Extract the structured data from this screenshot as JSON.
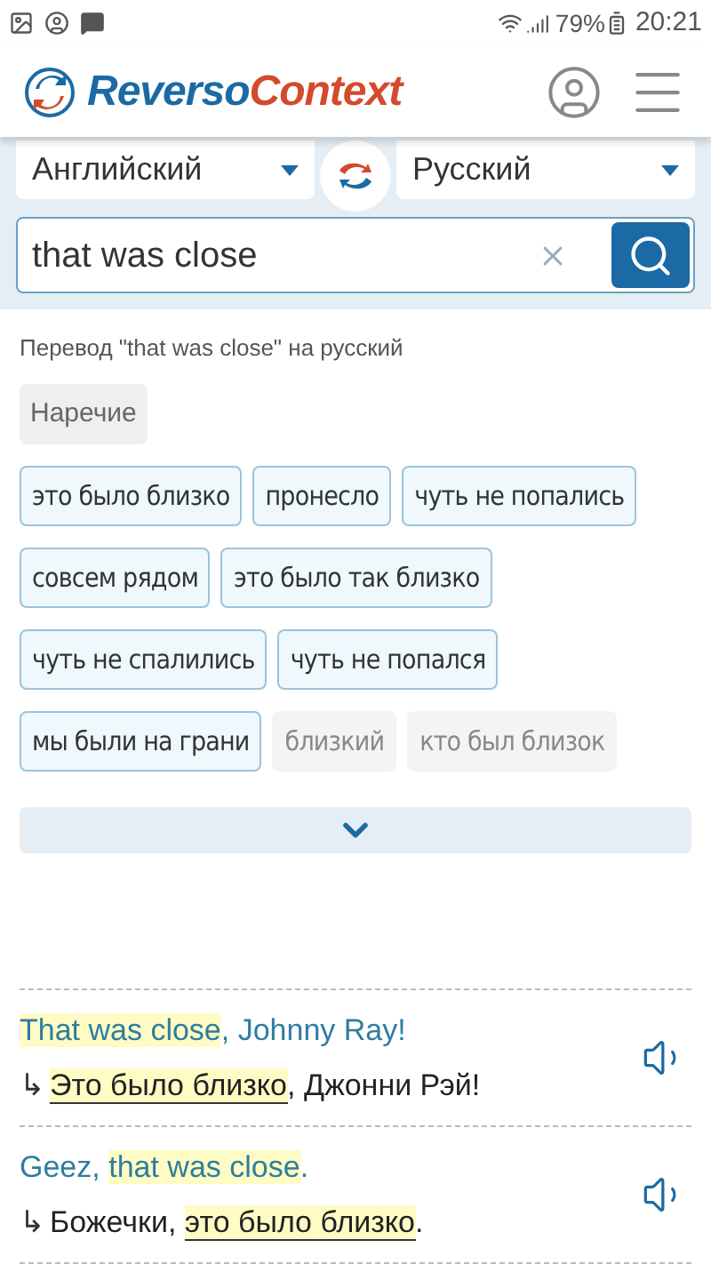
{
  "status_bar": {
    "battery": "79%",
    "time": "20:21"
  },
  "header": {
    "logo_part_1": "Reverso",
    "logo_part_2": "Context"
  },
  "languages": {
    "source": "Английский",
    "target": "Русский"
  },
  "search": {
    "value": "that was close"
  },
  "translation_heading": "Перевод \"that was close\" на русский",
  "part_of_speech": "Наречие",
  "translations": [
    {
      "text": "это было близко",
      "kind": "frequent"
    },
    {
      "text": "пронесло",
      "kind": "frequent"
    },
    {
      "text": "чуть не попались",
      "kind": "frequent"
    },
    {
      "text": "совсем рядом",
      "kind": "frequent"
    },
    {
      "text": "это было так близко",
      "kind": "frequent"
    },
    {
      "text": "чуть не спалились",
      "kind": "frequent"
    },
    {
      "text": "чуть не попался",
      "kind": "frequent"
    },
    {
      "text": "мы были на грани",
      "kind": "frequent"
    },
    {
      "text": "близкий",
      "kind": "rare"
    },
    {
      "text": "кто был близок",
      "kind": "rare"
    }
  ],
  "examples": [
    {
      "source": [
        {
          "text": "That was close",
          "highlighted": true
        },
        {
          "text": ", Johnny Ray!",
          "highlighted": false
        }
      ],
      "arrow": "↳",
      "target": [
        {
          "text": "Это было близко",
          "highlighted": true
        },
        {
          "text": ", Джонни Рэй!",
          "highlighted": false
        }
      ]
    },
    {
      "source": [
        {
          "text": "Geez, ",
          "highlighted": false
        },
        {
          "text": "that was close",
          "highlighted": true
        },
        {
          "text": ".",
          "highlighted": false
        }
      ],
      "arrow": "↳",
      "target": [
        {
          "text": "Божечки, ",
          "highlighted": false
        },
        {
          "text": "это было близко",
          "highlighted": true
        },
        {
          "text": ".",
          "highlighted": false
        }
      ]
    }
  ]
}
